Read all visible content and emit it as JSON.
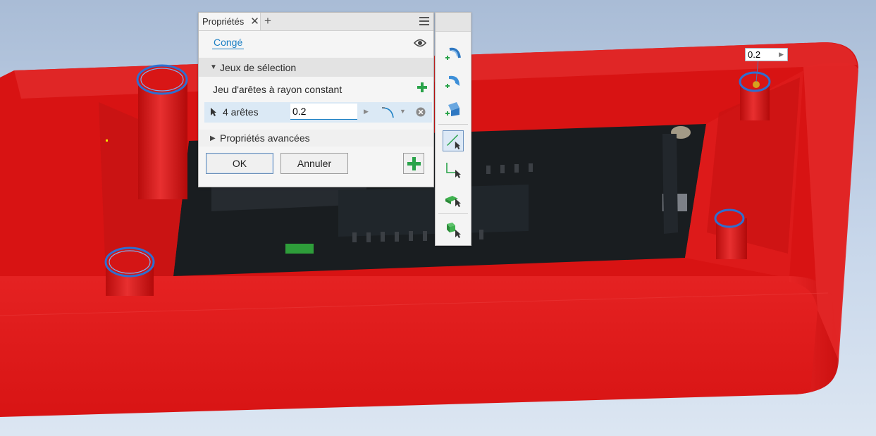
{
  "panel": {
    "tab_label": "Propriétés",
    "close_glyph": "✕",
    "add_glyph": "+",
    "feature_name": "Congé",
    "selection_sets": {
      "header": "Jeux de sélection",
      "edge_set_label": "Jeu d'arêtes à rayon constant",
      "edges_count": "4 arêtes",
      "radius_value": "0.2"
    },
    "advanced_header": "Propriétés avancées",
    "ok_label": "OK",
    "cancel_label": "Annuler"
  },
  "viewport": {
    "callout_value": "0.2"
  },
  "colors": {
    "part_red": "#e01616",
    "accent_blue": "#1a7fc4",
    "add_green": "#2aa34a",
    "selection_blue": "#dbe9f5"
  },
  "icons": {
    "toolbar": [
      "constant-fillet-icon",
      "variable-fillet-icon",
      "setback-icon",
      "edge-select-icon",
      "loop-select-icon",
      "feature-select-icon",
      "solid-select-icon"
    ]
  }
}
